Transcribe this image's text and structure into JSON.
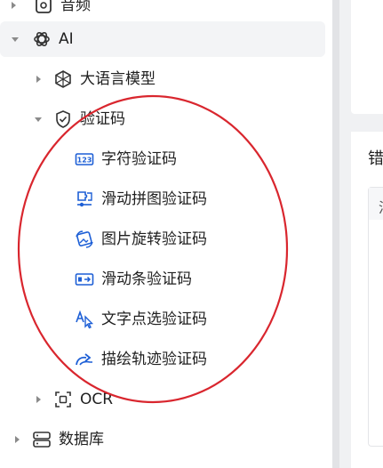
{
  "tree": {
    "top_item": {
      "label": "音频"
    },
    "ai": {
      "label": "AI"
    },
    "llm": {
      "label": "大语言模型"
    },
    "captcha": {
      "label": "验证码"
    },
    "captcha_children": [
      {
        "label": "字符验证码",
        "icon": "captcha-123-icon"
      },
      {
        "label": "滑动拼图验证码",
        "icon": "puzzle-slider-icon"
      },
      {
        "label": "图片旋转验证码",
        "icon": "image-rotate-icon"
      },
      {
        "label": "滑动条验证码",
        "icon": "slider-bar-icon"
      },
      {
        "label": "文字点选验证码",
        "icon": "text-click-icon"
      },
      {
        "label": "描绘轨迹验证码",
        "icon": "trace-path-icon"
      }
    ],
    "ocr": {
      "label": "OCR"
    },
    "database": {
      "label": "数据库"
    }
  },
  "right_panel": {
    "card_title": "错",
    "table_header": "洞"
  },
  "colors": {
    "annotation": "#d9262e",
    "icon_blue": "#1d5fd6",
    "selected_bg": "#f3f4f6"
  }
}
